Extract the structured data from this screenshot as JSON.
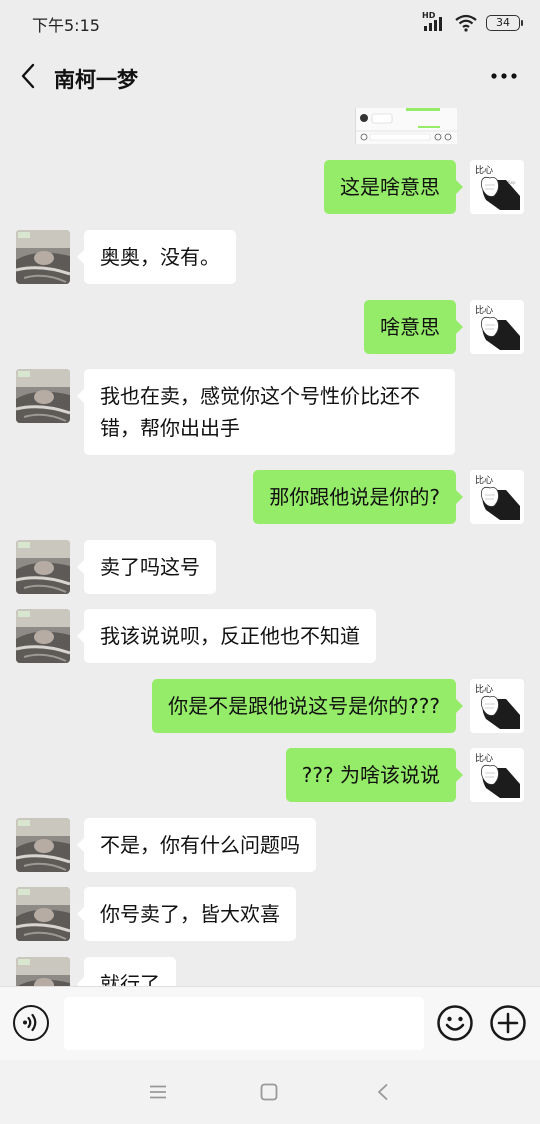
{
  "status_bar": {
    "time": "下午5:15",
    "network_label": "HD",
    "battery_level": "34"
  },
  "header": {
    "title": "南柯一梦"
  },
  "messages": [
    {
      "side": "right",
      "text": "这是啥意思"
    },
    {
      "side": "left",
      "text": "奥奥，没有。"
    },
    {
      "side": "right",
      "text": "啥意思"
    },
    {
      "side": "left",
      "text": "我也在卖，感觉你这个号性价比还不错，帮你出出手"
    },
    {
      "side": "right",
      "text": "那你跟他说是你的?"
    },
    {
      "side": "left",
      "text": "卖了吗这号"
    },
    {
      "side": "left",
      "text": "我该说说呗，反正他也不知道"
    },
    {
      "side": "right",
      "text": "你是不是跟他说这号是你的???"
    },
    {
      "side": "right",
      "text": "??? 为啥该说说"
    },
    {
      "side": "left",
      "text": "不是，你有什么问题吗"
    },
    {
      "side": "left",
      "text": "你号卖了，皆大欢喜"
    },
    {
      "side": "left",
      "text": "就行了"
    }
  ],
  "self_avatar_caption": "比心",
  "input": {
    "value": "",
    "placeholder": ""
  },
  "icons": {
    "back": "chevron-left-icon",
    "more": "more-horizontal-icon",
    "voice": "voice-icon",
    "emoji": "emoji-icon",
    "plus": "plus-circle-icon",
    "menu": "menu-icon",
    "home": "home-square-icon",
    "sys_back": "triangle-back-icon"
  },
  "colors": {
    "self_bubble": "#95ec69",
    "other_bubble": "#ffffff",
    "background": "#ededed"
  }
}
